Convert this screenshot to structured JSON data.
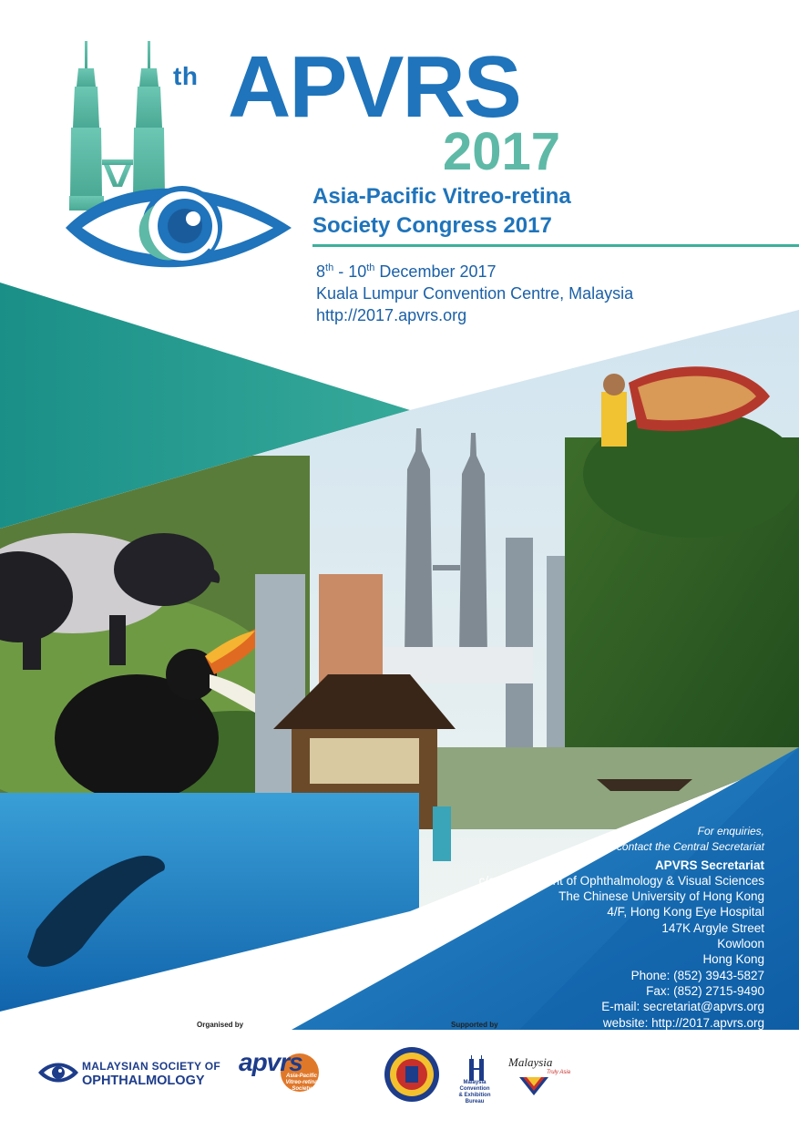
{
  "header": {
    "ordinal_suffix": "th",
    "acronym": "APVRS",
    "year": "2017",
    "title_line1": "Asia-Pacific Vitreo-retina",
    "title_line2": "Society Congress 2017",
    "date_start_day": "8",
    "date_start_suffix": "th",
    "date_separator": " - ",
    "date_end_day": "10",
    "date_end_suffix": "th",
    "date_rest": " December 2017",
    "venue": "Kuala Lumpur Convention Centre, Malaysia",
    "website": "http://2017.apvrs.org"
  },
  "contact": {
    "enquiry_line1": "For enquiries,",
    "enquiry_line2": "please contact the Central Secretariat",
    "org": "APVRS Secretariat",
    "lines": [
      "c/o Department of Ophthalmology & Visual Sciences",
      "The Chinese University of Hong Kong",
      "4/F, Hong Kong Eye Hospital",
      "147K Argyle Street",
      "Kowloon",
      "Hong Kong",
      "Phone: (852) 3943-5827",
      "Fax: (852) 2715-9490",
      "E-mail: secretariat@apvrs.org",
      "website: http://2017.apvrs.org"
    ]
  },
  "footer": {
    "organised_by": "Organised by",
    "supported_by": "Supported by",
    "mso_line1": "MALAYSIAN SOCIETY OF",
    "mso_line2": "OPHTHALMOLOGY",
    "apvrs_logo_word": "apvrs",
    "apvrs_logo_sub1": "Asia-Pacific",
    "apvrs_logo_sub2": "Vitreo-retina",
    "apvrs_logo_sub3": "Society",
    "mycbe_line1": "Malaysia",
    "mycbe_line2": "Convention",
    "mycbe_line3": "& Exhibition",
    "mycbe_line4": "Bureau",
    "tourism_word": "Malaysia",
    "tourism_tag": "Truly Asia"
  },
  "colors": {
    "brand_blue": "#1f74bb",
    "teal": "#5fb9a7",
    "dark_blue": "#1a60a8",
    "navy": "#1d3c8a"
  }
}
